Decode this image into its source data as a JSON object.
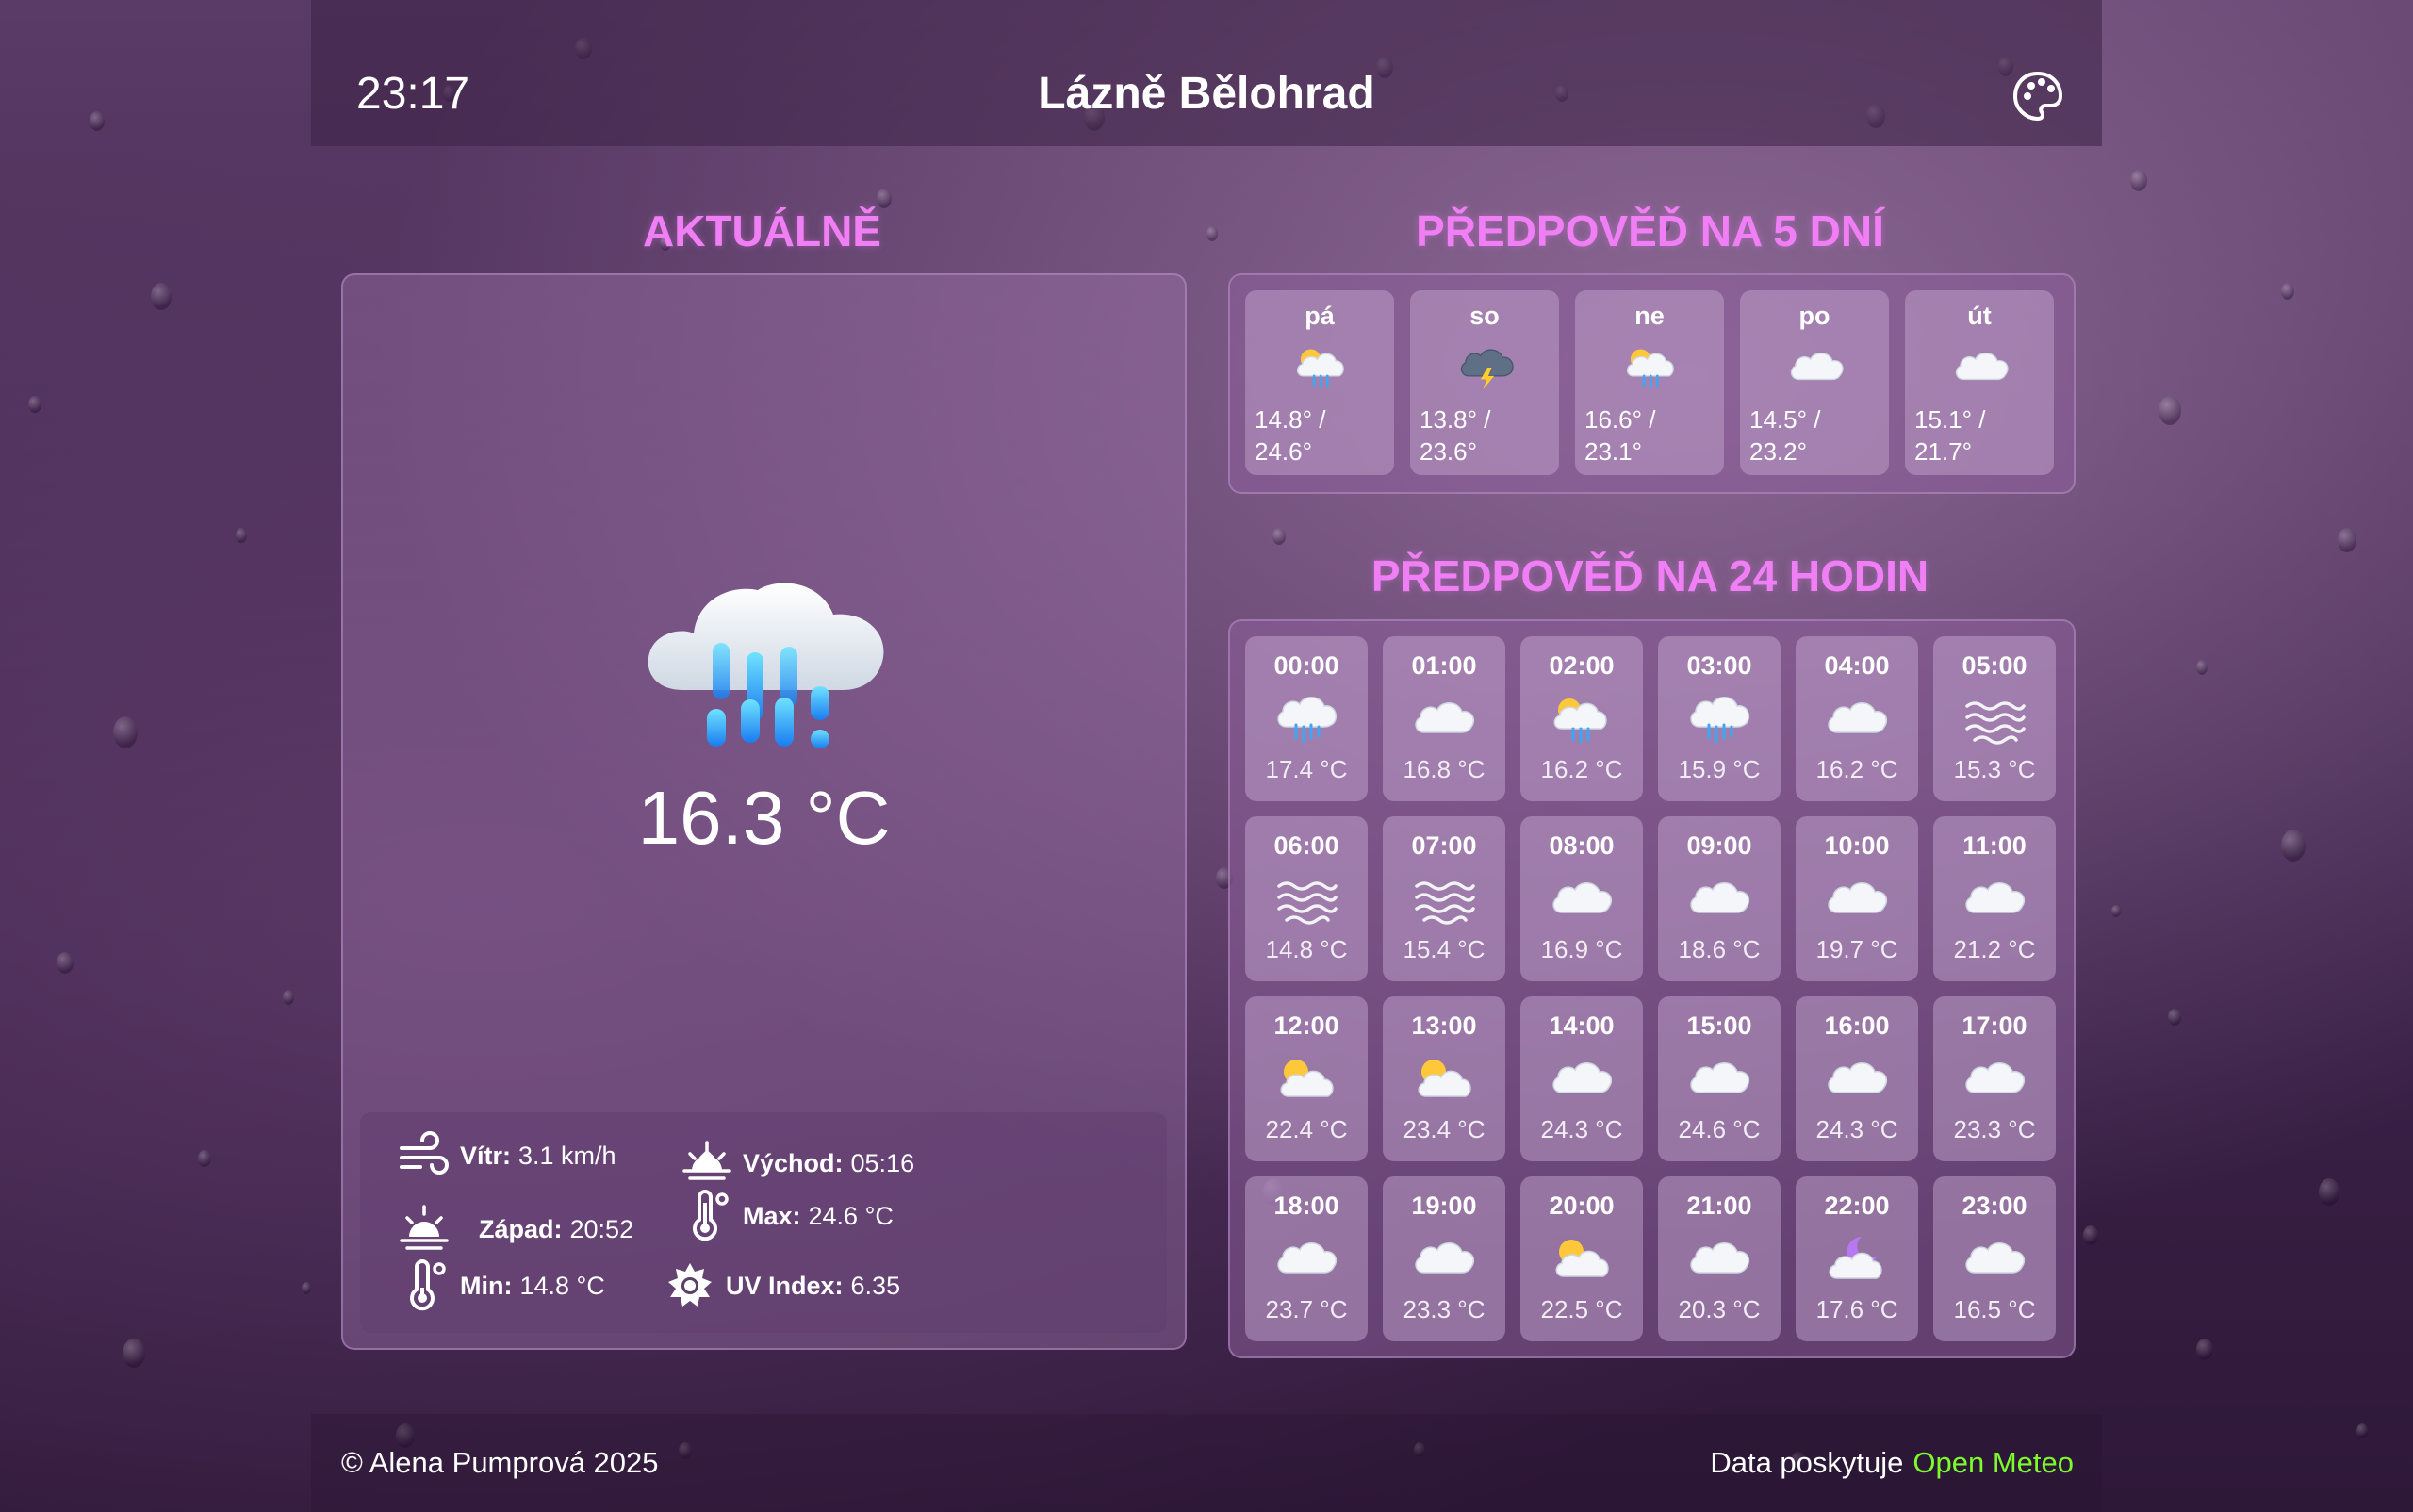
{
  "header": {
    "time": "23:17",
    "city": "Lázně Bělohrad",
    "palette_icon": "palette-icon"
  },
  "current": {
    "title": "AKTUÁLNĚ",
    "icon": "rain-cloud-icon",
    "temp": "16.3 °C",
    "wind_label": "Vítr:",
    "wind_value": "3.1 km/h",
    "sunrise_label": "Východ:",
    "sunrise_value": "05:16",
    "sunset_label": "Západ:",
    "sunset_value": "20:52",
    "max_label": "Max:",
    "max_value": "24.6 °C",
    "min_label": "Min:",
    "min_value": "14.8 °C",
    "uv_label": "UV Index:",
    "uv_value": "6.35"
  },
  "forecast5": {
    "title": "PŘEDPOVĚĎ NA 5 DNÍ",
    "days": [
      {
        "day": "pá",
        "icon": "sun-rain-icon",
        "min": "14.8° /",
        "max": "24.6°"
      },
      {
        "day": "so",
        "icon": "thunderstorm-icon",
        "min": "13.8° /",
        "max": "23.6°"
      },
      {
        "day": "ne",
        "icon": "sun-rain-icon",
        "min": "16.6° /",
        "max": "23.1°"
      },
      {
        "day": "po",
        "icon": "cloud-icon",
        "min": "14.5° /",
        "max": "23.2°"
      },
      {
        "day": "út",
        "icon": "cloud-icon",
        "min": "15.1° /",
        "max": "21.7°"
      }
    ]
  },
  "forecast24": {
    "title": "PŘEDPOVĚĎ NA 24 HODIN",
    "hours": [
      {
        "time": "00:00",
        "icon": "rain-cloud-icon",
        "temp": "17.4 °C"
      },
      {
        "time": "01:00",
        "icon": "cloud-icon",
        "temp": "16.8 °C"
      },
      {
        "time": "02:00",
        "icon": "sun-rain-icon",
        "temp": "16.2 °C"
      },
      {
        "time": "03:00",
        "icon": "rain-cloud-icon",
        "temp": "15.9 °C"
      },
      {
        "time": "04:00",
        "icon": "cloud-icon",
        "temp": "16.2 °C"
      },
      {
        "time": "05:00",
        "icon": "fog-icon",
        "temp": "15.3 °C"
      },
      {
        "time": "06:00",
        "icon": "fog-icon",
        "temp": "14.8 °C"
      },
      {
        "time": "07:00",
        "icon": "fog-icon",
        "temp": "15.4 °C"
      },
      {
        "time": "08:00",
        "icon": "cloud-icon",
        "temp": "16.9 °C"
      },
      {
        "time": "09:00",
        "icon": "cloud-icon",
        "temp": "18.6 °C"
      },
      {
        "time": "10:00",
        "icon": "cloud-icon",
        "temp": "19.7 °C"
      },
      {
        "time": "11:00",
        "icon": "cloud-icon",
        "temp": "21.2 °C"
      },
      {
        "time": "12:00",
        "icon": "sun-cloud-icon",
        "temp": "22.4 °C"
      },
      {
        "time": "13:00",
        "icon": "sun-cloud-icon",
        "temp": "23.4 °C"
      },
      {
        "time": "14:00",
        "icon": "cloud-icon",
        "temp": "24.3 °C"
      },
      {
        "time": "15:00",
        "icon": "cloud-icon",
        "temp": "24.6 °C"
      },
      {
        "time": "16:00",
        "icon": "cloud-icon",
        "temp": "24.3 °C"
      },
      {
        "time": "17:00",
        "icon": "cloud-icon",
        "temp": "23.3 °C"
      },
      {
        "time": "18:00",
        "icon": "cloud-icon",
        "temp": "23.7 °C"
      },
      {
        "time": "19:00",
        "icon": "cloud-icon",
        "temp": "23.3 °C"
      },
      {
        "time": "20:00",
        "icon": "sun-cloud-icon",
        "temp": "22.5 °C"
      },
      {
        "time": "21:00",
        "icon": "cloud-icon",
        "temp": "20.3 °C"
      },
      {
        "time": "22:00",
        "icon": "moon-cloud-icon",
        "temp": "17.6 °C"
      },
      {
        "time": "23:00",
        "icon": "cloud-icon",
        "temp": "16.5 °C"
      }
    ]
  },
  "footer": {
    "copyright": "© Alena Pumprová 2025",
    "source_label": "Data poskytuje",
    "source_link": "Open Meteo"
  },
  "colors": {
    "accent_title": "#f07ef4",
    "link": "#7cfc2a"
  }
}
